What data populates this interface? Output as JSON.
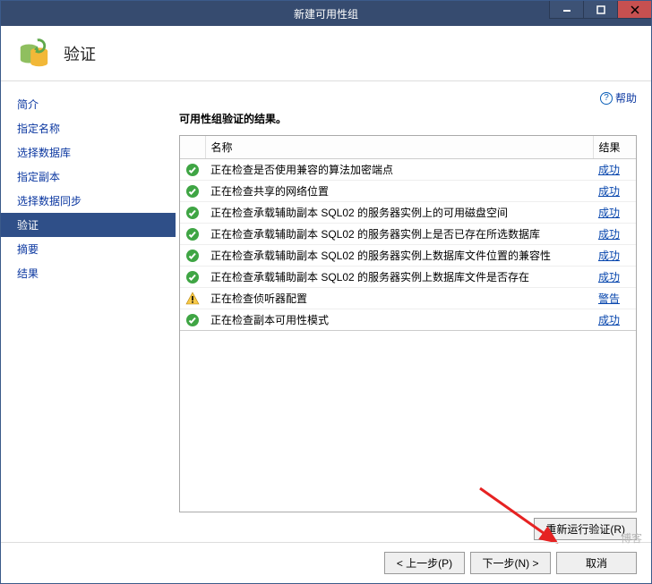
{
  "titlebar": {
    "title": "新建可用性组"
  },
  "header": {
    "title": "验证"
  },
  "sidebar": {
    "items": [
      {
        "label": "简介"
      },
      {
        "label": "指定名称"
      },
      {
        "label": "选择数据库"
      },
      {
        "label": "指定副本"
      },
      {
        "label": "选择数据同步"
      },
      {
        "label": "验证"
      },
      {
        "label": "摘要"
      },
      {
        "label": "结果"
      }
    ],
    "selected_index": 5
  },
  "content": {
    "help_label": "帮助",
    "heading": "可用性组验证的结果。",
    "table": {
      "columns": [
        "",
        "名称",
        "结果"
      ],
      "rows": [
        {
          "status": "success",
          "name": "正在检查是否使用兼容的算法加密端点",
          "result": "成功"
        },
        {
          "status": "success",
          "name": "正在检查共享的网络位置",
          "result": "成功"
        },
        {
          "status": "success",
          "name": "正在检查承载辅助副本 SQL02 的服务器实例上的可用磁盘空间",
          "result": "成功"
        },
        {
          "status": "success",
          "name": "正在检查承载辅助副本 SQL02 的服务器实例上是否已存在所选数据库",
          "result": "成功"
        },
        {
          "status": "success",
          "name": "正在检查承载辅助副本 SQL02 的服务器实例上数据库文件位置的兼容性",
          "result": "成功"
        },
        {
          "status": "success",
          "name": "正在检查承载辅助副本 SQL02 的服务器实例上数据库文件是否存在",
          "result": "成功"
        },
        {
          "status": "warning",
          "name": "正在检查侦听器配置",
          "result": "警告"
        },
        {
          "status": "success",
          "name": "正在检查副本可用性模式",
          "result": "成功"
        }
      ]
    },
    "rerun_label": "重新运行验证(R)"
  },
  "footer": {
    "prev": "< 上一步(P)",
    "next": "下一步(N) >",
    "cancel": "取消"
  },
  "watermark": "博客"
}
